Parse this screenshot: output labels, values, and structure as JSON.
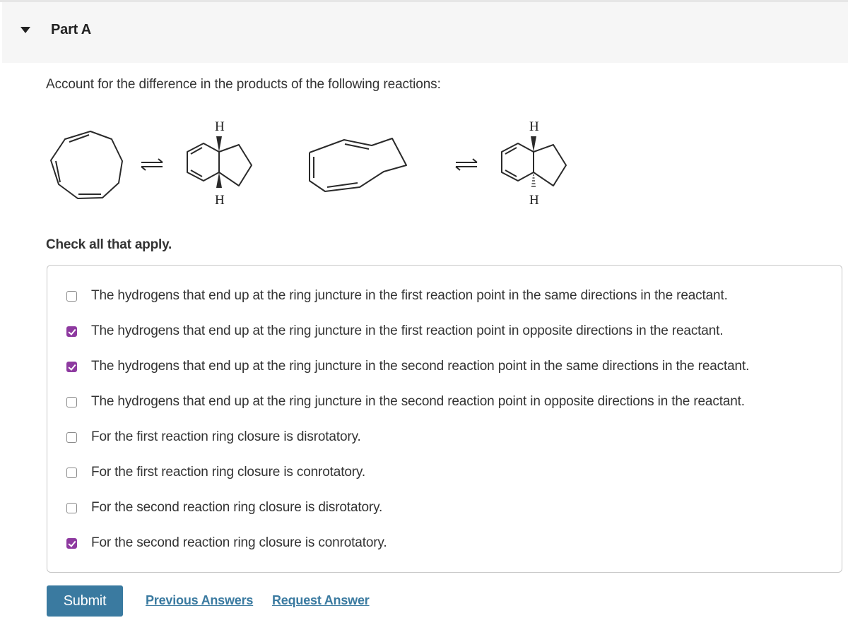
{
  "part": {
    "title": "Part A",
    "expanded": true
  },
  "question": {
    "prompt": "Account for the difference in the products of the following reactions:",
    "reactions": [
      {
        "reactant": "cis,cis,cis-1,3,5-cyclononatriene",
        "product": "cis-fused bicyclic diene",
        "equilibrium_symbol": "⇌",
        "top_h_label": "H",
        "bottom_h_label": "H",
        "top_h_bond": "wedge",
        "bottom_h_bond": "wedge"
      },
      {
        "reactant": "cis,cis,trans-1,3,5-cyclononatriene",
        "product": "trans-fused bicyclic diene",
        "equilibrium_symbol": "⇌",
        "top_h_label": "H",
        "bottom_h_label": "H",
        "top_h_bond": "wedge",
        "bottom_h_bond": "hash"
      }
    ],
    "instruction": "Check all that apply."
  },
  "options": [
    {
      "label": "The hydrogens that end up at the ring juncture in the first reaction point in the same directions in the reactant.",
      "checked": false
    },
    {
      "label": "The hydrogens that end up at the ring juncture in the first reaction point in opposite directions in the reactant.",
      "checked": true
    },
    {
      "label": "The hydrogens that end up at the ring juncture in the second reaction point in the same directions in the reactant.",
      "checked": true
    },
    {
      "label": "The hydrogens that end up at the ring juncture in the second reaction point in opposite directions in the reactant.",
      "checked": false
    },
    {
      "label": "For the first reaction ring closure is disrotatory.",
      "checked": false
    },
    {
      "label": "For the first reaction ring closure is conrotatory.",
      "checked": false
    },
    {
      "label": "For the second reaction ring closure is disrotatory.",
      "checked": false
    },
    {
      "label": "For the second reaction ring closure is conrotatory.",
      "checked": true
    }
  ],
  "actions": {
    "submit_label": "Submit",
    "previous_answers_label": "Previous Answers",
    "request_answer_label": "Request Answer"
  },
  "colors": {
    "checkbox_checked": "#8e3aa0",
    "button_bg": "#3a7aa0",
    "link": "#3a7aa0",
    "header_bg": "#f6f6f6"
  }
}
